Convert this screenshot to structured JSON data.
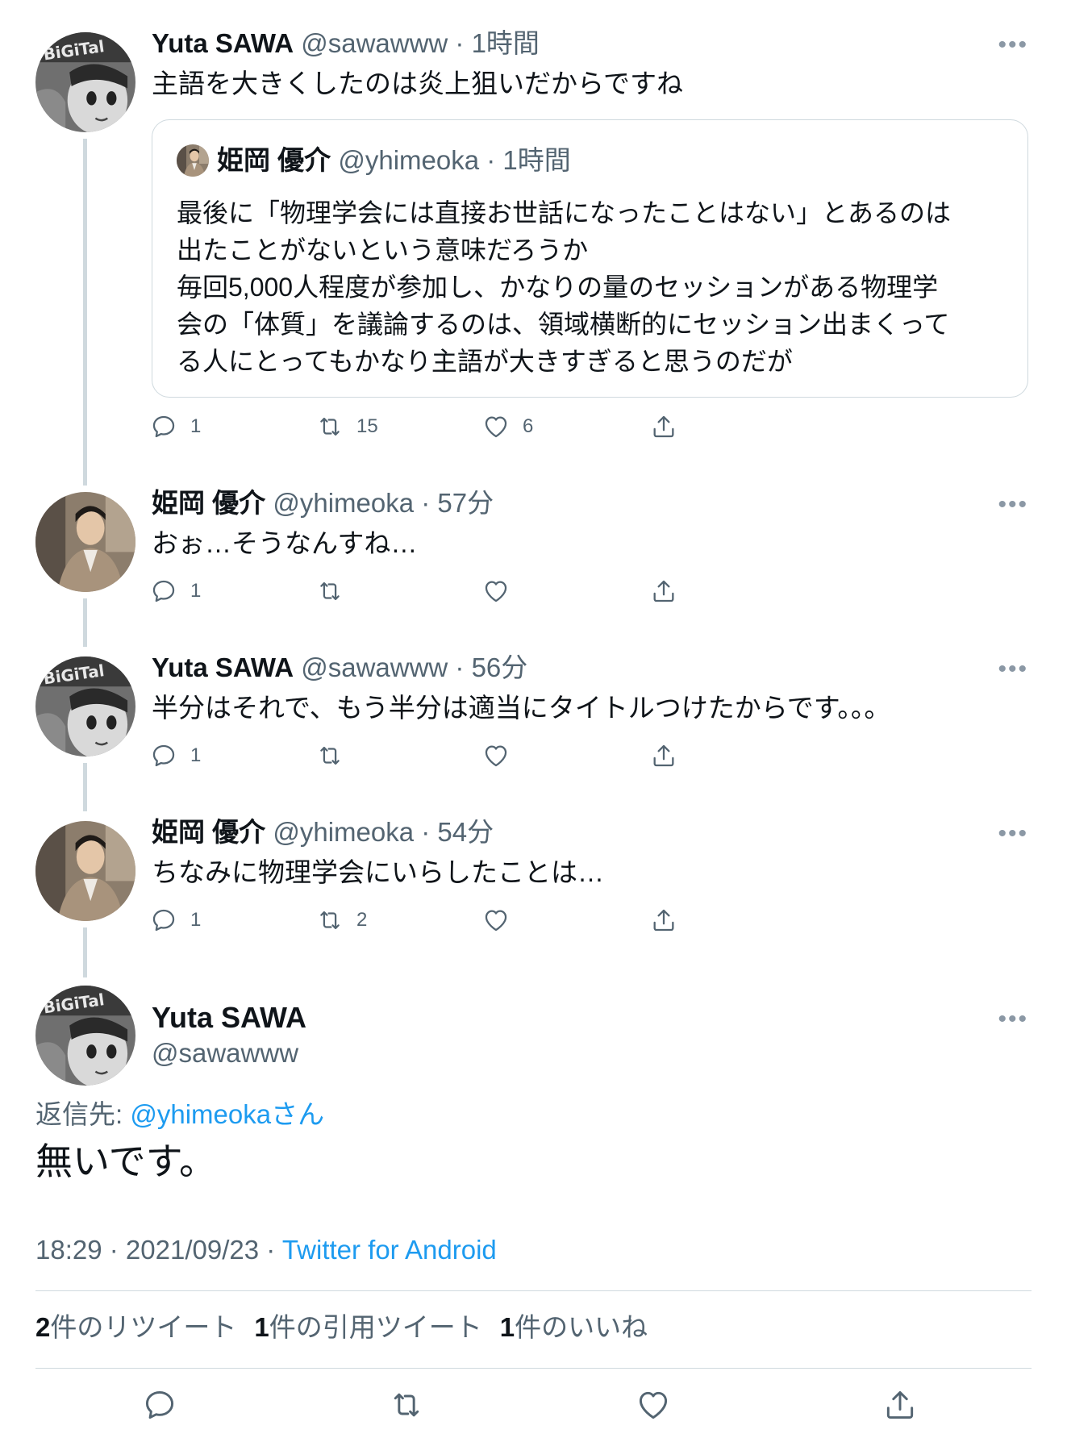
{
  "tweets": [
    {
      "name": "Yuta SAWA",
      "meta": "@sawawww · 1時間",
      "text": "主語を大きくしたのは炎上狙いだからですね",
      "reply_count": "1",
      "retweet_count": "15",
      "like_count": "6",
      "quote": {
        "name": "姫岡 優介",
        "meta": "@yhimeoka · 1時間",
        "lines": [
          "最後に「物理学会には直接お世話になったことはない」とあるのは",
          "出たことがないという意味だろうか",
          "毎回5,000人程度が参加し、かなりの量のセッションがある物理学",
          "会の「体質」を議論するのは、領域横断的にセッション出まくって",
          "る人にとってもかなり主語が大きすぎると思うのだが"
        ]
      }
    },
    {
      "name": "姫岡 優介",
      "meta": "@yhimeoka · 57分",
      "text": "おぉ…そうなんすね…",
      "reply_count": "1",
      "retweet_count": "",
      "like_count": ""
    },
    {
      "name": "Yuta SAWA",
      "meta": "@sawawww · 56分",
      "text": "半分はそれで、もう半分は適当にタイトルつけたからです。。。",
      "reply_count": "1",
      "retweet_count": "",
      "like_count": ""
    },
    {
      "name": "姫岡 優介",
      "meta": "@yhimeoka · 54分",
      "text": "ちなみに物理学会にいらしたことは…",
      "reply_count": "1",
      "retweet_count": "2",
      "like_count": ""
    }
  ],
  "main_tweet": {
    "name": "Yuta SAWA",
    "handle": "@sawawww",
    "reply_to_label": "返信先: ",
    "reply_to_mention": "@yhimeokaさん",
    "text": "無いです。",
    "timestamp": "18:29 · 2021/09/23 · ",
    "source": "Twitter for Android",
    "stats": {
      "retweets_num": "2",
      "retweets_label": "件のリツイート",
      "quotes_num": "1",
      "quotes_label": "件の引用ツイート",
      "likes_num": "1",
      "likes_label": "件のいいね"
    }
  },
  "more_label": "•••",
  "icons": {
    "reply": "reply-icon",
    "retweet": "retweet-icon",
    "like": "heart-icon",
    "share": "share-icon"
  },
  "colors": {
    "text": "#0f1419",
    "secondary": "#536471",
    "link": "#1d9bf0",
    "border": "#cfd9de"
  }
}
